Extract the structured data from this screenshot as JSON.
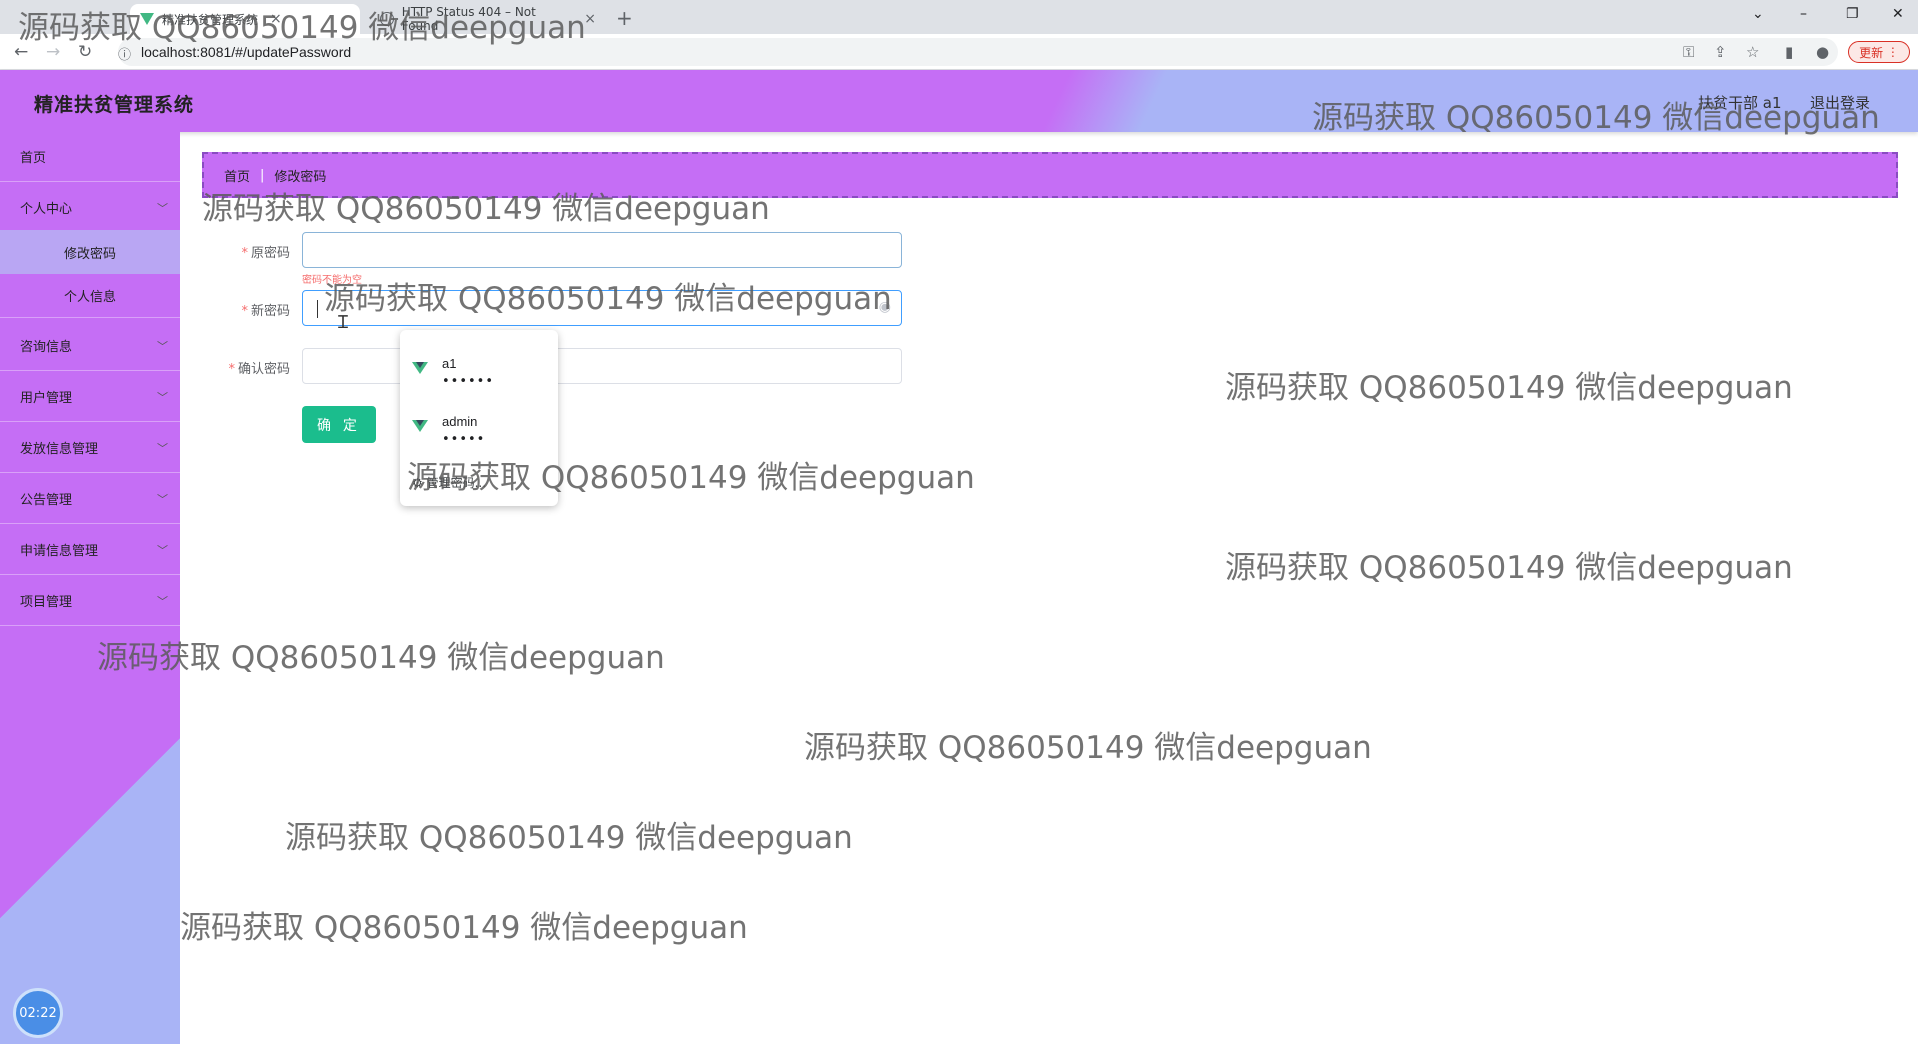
{
  "browser": {
    "tabs": [
      {
        "title": "精准扶贫管理系统",
        "active": true
      },
      {
        "title": "HTTP Status 404 – Not Found",
        "active": false
      }
    ],
    "new_tab": "+",
    "url": "localhost:8081/#/updatePassword",
    "update_label": "更新"
  },
  "header": {
    "title": "精准扶贫管理系统",
    "user": "扶贫干部 a1",
    "logout": "退出登录"
  },
  "sidebar": {
    "items": [
      {
        "label": "首页"
      },
      {
        "label": "个人中心"
      },
      {
        "label": "修改密码"
      },
      {
        "label": "个人信息"
      },
      {
        "label": "咨询信息"
      },
      {
        "label": "用户管理"
      },
      {
        "label": "发放信息管理"
      },
      {
        "label": "公告管理"
      },
      {
        "label": "申请信息管理"
      },
      {
        "label": "项目管理"
      }
    ],
    "clock": "02:22"
  },
  "breadcrumb": {
    "home": "首页",
    "current": "修改密码"
  },
  "form": {
    "old_password_label": "原密码",
    "new_password_label": "新密码",
    "confirm_password_label": "确认密码",
    "error_tip": "密码不能为空",
    "submit_label": "确 定"
  },
  "autofill": {
    "items": [
      {
        "user": "a1",
        "password": "••••••"
      },
      {
        "user": "admin",
        "password": "•••••"
      }
    ],
    "manage": "管理密码..."
  },
  "watermark": "源码获取 QQ86050149 微信deepguan"
}
